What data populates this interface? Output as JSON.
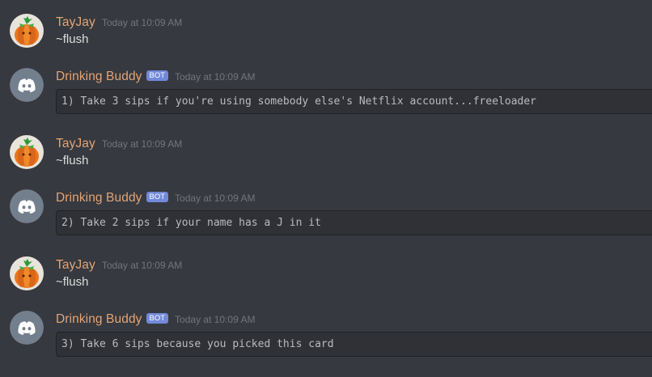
{
  "colors": {
    "background": "#36393f",
    "username": "#e3a476",
    "bot_tag": "#7289da",
    "timestamp": "#72767d",
    "message_text": "#dcddde",
    "codeblock_bg": "#2f3136",
    "bot_avatar_bg": "#747f8d"
  },
  "messages": [
    {
      "author": "TayJay",
      "avatar_icon": "pumpkin-avatar-icon",
      "timestamp": "Today at 10:09 AM",
      "text": "~flush"
    },
    {
      "author": "Drinking Buddy",
      "avatar_icon": "discord-logo-icon",
      "bot_tag": "BOT",
      "timestamp": "Today at 10:09 AM",
      "code": "1) Take 3 sips if you're using somebody else's Netflix account...freeloader"
    },
    {
      "author": "TayJay",
      "avatar_icon": "pumpkin-avatar-icon",
      "timestamp": "Today at 10:09 AM",
      "text": "~flush"
    },
    {
      "author": "Drinking Buddy",
      "avatar_icon": "discord-logo-icon",
      "bot_tag": "BOT",
      "timestamp": "Today at 10:09 AM",
      "code": "2) Take 2 sips if your name has a J in it"
    },
    {
      "author": "TayJay",
      "avatar_icon": "pumpkin-avatar-icon",
      "timestamp": "Today at 10:09 AM",
      "text": "~flush"
    },
    {
      "author": "Drinking Buddy",
      "avatar_icon": "discord-logo-icon",
      "bot_tag": "BOT",
      "timestamp": "Today at 10:09 AM",
      "code": "3) Take 6 sips because you picked this card"
    }
  ]
}
